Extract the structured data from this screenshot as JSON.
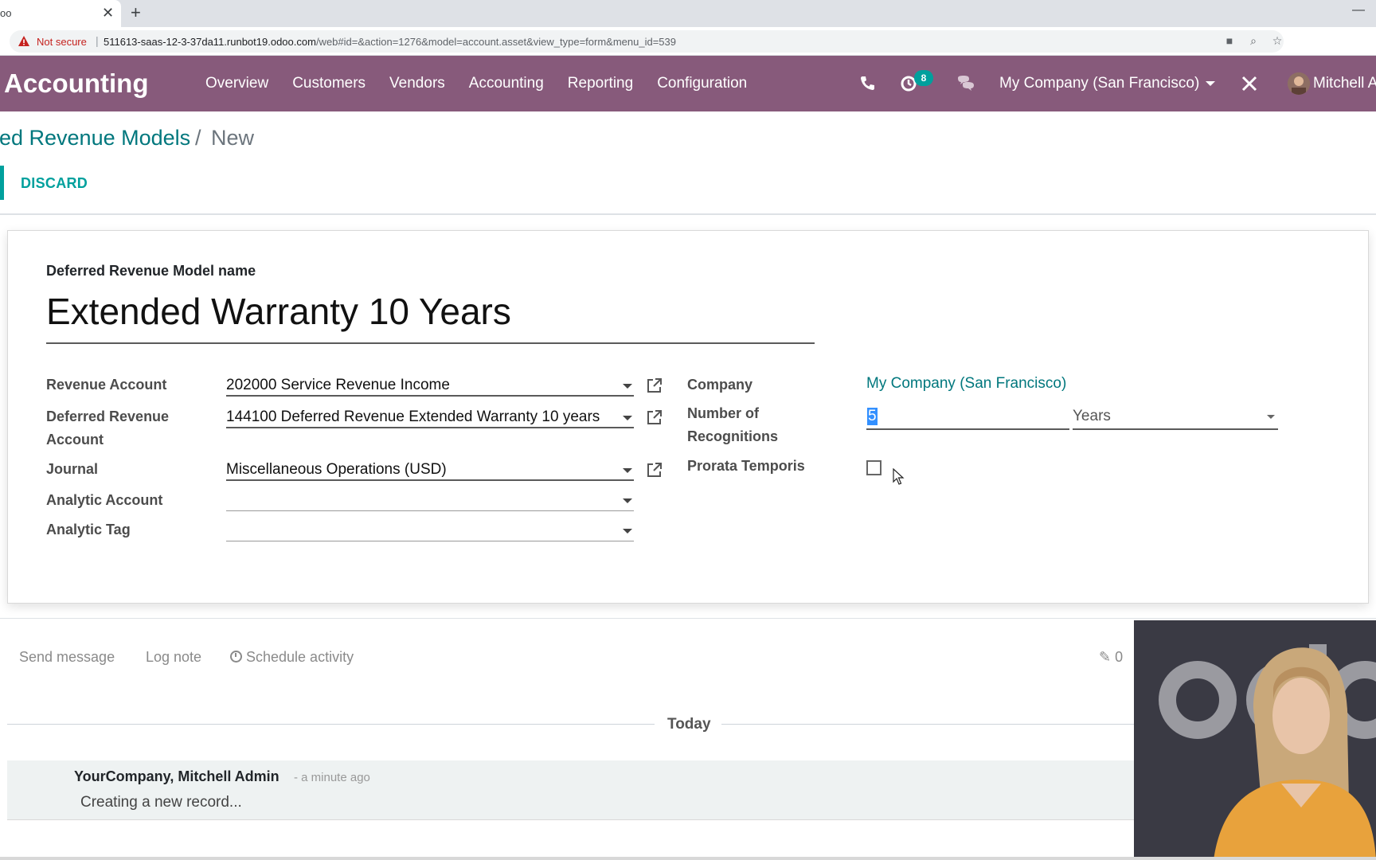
{
  "browser": {
    "tab_title": "oo",
    "url_host": "511613-saas-12-3-37da11.runbot19.odoo.com",
    "url_path": "/web#id=&action=1276&model=account.asset&view_type=form&menu_id=539",
    "not_secure": "Not secure",
    "icons": [
      "camera-icon",
      "zoom-icon",
      "star-icon"
    ]
  },
  "navbar": {
    "app": "Accounting",
    "menu": [
      "Overview",
      "Customers",
      "Vendors",
      "Accounting",
      "Reporting",
      "Configuration"
    ],
    "activity_count": "8",
    "company": "My Company (San Francisco)",
    "user": "Mitchell A",
    "color": "#875a7b"
  },
  "breadcrumb": {
    "parent": "red Revenue Models",
    "separator": "/",
    "current": "New"
  },
  "toolbar": {
    "discard": "DISCARD"
  },
  "form": {
    "title_label": "Deferred Revenue Model name",
    "title_value": "Extended Warranty 10 Years",
    "revenue_account_label": "Revenue Account",
    "revenue_account_value": "202000 Service Revenue Income",
    "deferred_account_label_1": "Deferred Revenue",
    "deferred_account_label_2": "Account",
    "deferred_account_value": "144100 Deferred Revenue Extended Warranty 10 years",
    "journal_label": "Journal",
    "journal_value": "Miscellaneous Operations (USD)",
    "analytic_account_label": "Analytic Account",
    "analytic_account_value": "",
    "analytic_tag_label": "Analytic Tag",
    "analytic_tag_value": "",
    "company_label": "Company",
    "company_value": "My Company (San Francisco)",
    "recognitions_label_1": "Number of",
    "recognitions_label_2": "Recognitions",
    "recognitions_value": "5",
    "period_value": "Years",
    "prorata_label": "Prorata Temporis",
    "prorata_checked": false
  },
  "chatter": {
    "send_message": "Send message",
    "log_note": "Log note",
    "schedule_activity": "Schedule activity",
    "attachments": "0",
    "today": "Today",
    "messages": [
      {
        "author": "YourCompany, Mitchell Admin",
        "date": "- a minute ago",
        "body": "Creating a new record..."
      }
    ]
  },
  "colors": {
    "primary": "#875a7b",
    "accent": "#00a09d",
    "link": "#00777d"
  }
}
